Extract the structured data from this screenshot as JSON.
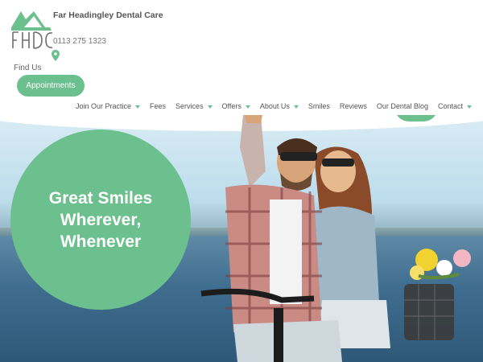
{
  "header": {
    "site_name": "Far Headingley Dental Care",
    "logo_letters": "FHDC",
    "phone": "0113 275 1323",
    "find_us": "Find Us",
    "appointments_button": "Appointments"
  },
  "nav": [
    {
      "label": "Join Our Practice",
      "dropdown": true
    },
    {
      "label": "Fees",
      "dropdown": false
    },
    {
      "label": "Services",
      "dropdown": true
    },
    {
      "label": "Offers",
      "dropdown": true
    },
    {
      "label": "About Us",
      "dropdown": true
    },
    {
      "label": "Smiles",
      "dropdown": false
    },
    {
      "label": "Reviews",
      "dropdown": false
    },
    {
      "label": "Our Dental Blog",
      "dropdown": false
    },
    {
      "label": "Contact",
      "dropdown": true
    }
  ],
  "hero": {
    "line1": "Great Smiles",
    "line2": "Wherever,",
    "line3": "Whenever"
  },
  "colors": {
    "brand_green": "#6cc08e",
    "text_gray": "#555555"
  },
  "icons": [
    "house-roof-icon",
    "location-pin-icon",
    "chevron-down-icon"
  ]
}
